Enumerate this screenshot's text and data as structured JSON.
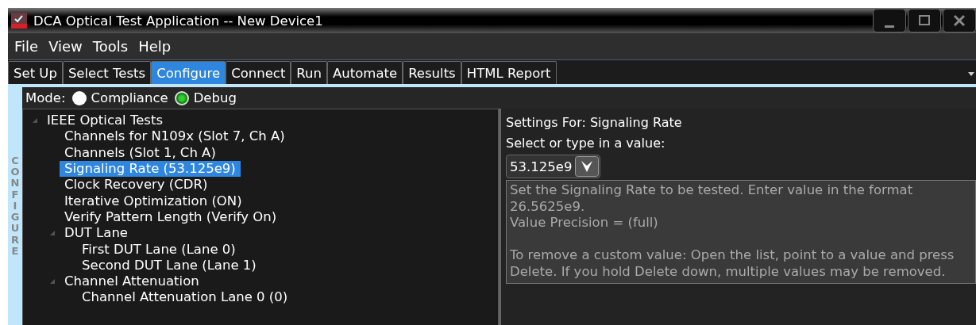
{
  "window": {
    "title": "DCA Optical Test Application -- New Device1"
  },
  "menu": [
    "File",
    "View",
    "Tools",
    "Help"
  ],
  "tabs": [
    {
      "label": "Set Up",
      "selected": false
    },
    {
      "label": "Select Tests",
      "selected": false
    },
    {
      "label": "Configure",
      "selected": true
    },
    {
      "label": "Connect",
      "selected": false
    },
    {
      "label": "Run",
      "selected": false
    },
    {
      "label": "Automate",
      "selected": false
    },
    {
      "label": "Results",
      "selected": false
    },
    {
      "label": "HTML Report",
      "selected": false
    }
  ],
  "side_label": "CONFIGURE",
  "mode": {
    "label": "Mode:",
    "options": [
      {
        "label": "Compliance",
        "selected": false
      },
      {
        "label": "Debug",
        "selected": true
      }
    ]
  },
  "tree": [
    {
      "label": "IEEE Optical Tests",
      "expanded": true,
      "selected": false,
      "children": [
        {
          "label": "Channels for N109x (Slot 7, Ch A)",
          "selected": false
        },
        {
          "label": "Channels (Slot 1, Ch A)",
          "selected": false
        },
        {
          "label": "Signaling Rate (53.125e9)",
          "selected": true
        },
        {
          "label": "Clock Recovery (CDR)",
          "selected": false
        },
        {
          "label": "Iterative Optimization (ON)",
          "selected": false
        },
        {
          "label": "Verify Pattern Length (Verify On)",
          "selected": false
        },
        {
          "label": "DUT Lane",
          "expanded": true,
          "selected": false,
          "children": [
            {
              "label": "First DUT Lane (Lane 0)",
              "selected": false
            },
            {
              "label": "Second DUT Lane (Lane 1)",
              "selected": false
            }
          ]
        },
        {
          "label": "Channel Attenuation",
          "expanded": true,
          "selected": false,
          "children": [
            {
              "label": "Channel Attenuation Lane 0 (0)",
              "selected": false
            }
          ]
        }
      ]
    }
  ],
  "settings": {
    "title": "Settings For: Signaling Rate",
    "prompt": "Select or type in a value:",
    "value": "53.125e9",
    "description": [
      "Set the Signaling Rate to be tested. Enter value in the format 26.5625e9.",
      "Value Precision = (full)",
      "To remove a custom value: Open the list, point to a value and press Delete. If you hold Delete down, multiple values may be removed."
    ]
  }
}
